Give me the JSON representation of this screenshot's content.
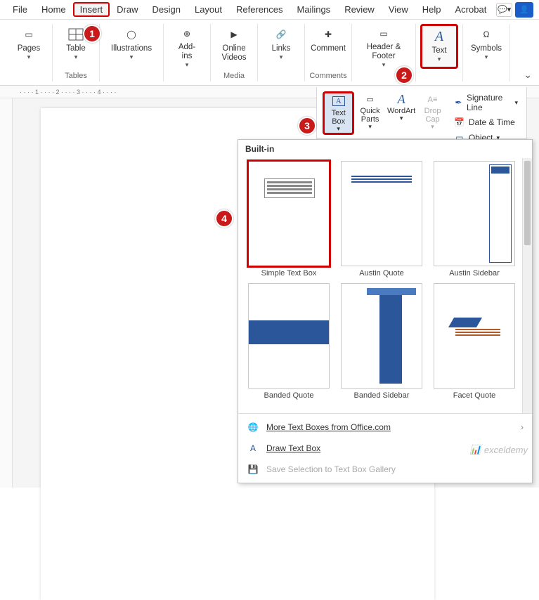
{
  "menubar": {
    "items": [
      "File",
      "Home",
      "Insert",
      "Draw",
      "Design",
      "Layout",
      "References",
      "Mailings",
      "Review",
      "View",
      "Help",
      "Acrobat"
    ],
    "active_idx": 2,
    "comment_icon": "comment",
    "share_icon": "share"
  },
  "ribbon": {
    "pages": "Pages",
    "table": "Table",
    "illustrations": "Illustrations",
    "addins": "Add-\nins",
    "online_videos": "Online\nVideos",
    "links": "Links",
    "comment": "Comment",
    "header_footer": "Header &\nFooter",
    "text": "Text",
    "symbols": "Symbols",
    "groups": {
      "tables": "Tables",
      "media": "Media",
      "comments": "Comments"
    }
  },
  "sub_ribbon": {
    "text_box": "Text\nBox",
    "quick_parts": "Quick\nParts",
    "wordart": "WordArt",
    "drop_cap": "Drop\nCap",
    "signature": "Signature Line",
    "date_time": "Date & Time",
    "object": "Object"
  },
  "dropdown": {
    "section": "Built-in",
    "items": [
      {
        "label": "Simple Text Box",
        "style": "simple",
        "highlight": true
      },
      {
        "label": "Austin Quote",
        "style": "austin-q",
        "highlight": false
      },
      {
        "label": "Austin Sidebar",
        "style": "austin-s",
        "highlight": false
      },
      {
        "label": "Banded Quote",
        "style": "banded-q",
        "highlight": false
      },
      {
        "label": "Banded Sidebar",
        "style": "banded-s",
        "highlight": false
      },
      {
        "label": "Facet Quote",
        "style": "facet",
        "highlight": false
      }
    ],
    "more": "More Text Boxes from Office.com",
    "draw": "Draw Text Box",
    "save": "Save Selection to Text Box Gallery"
  },
  "badges": {
    "b1": "1",
    "b2": "2",
    "b3": "3",
    "b4": "4"
  },
  "watermark": "exceldemy",
  "ruler_marks": "· · · · 1 · · · · 2 · · · · 3 · · · · 4 · · · ·"
}
